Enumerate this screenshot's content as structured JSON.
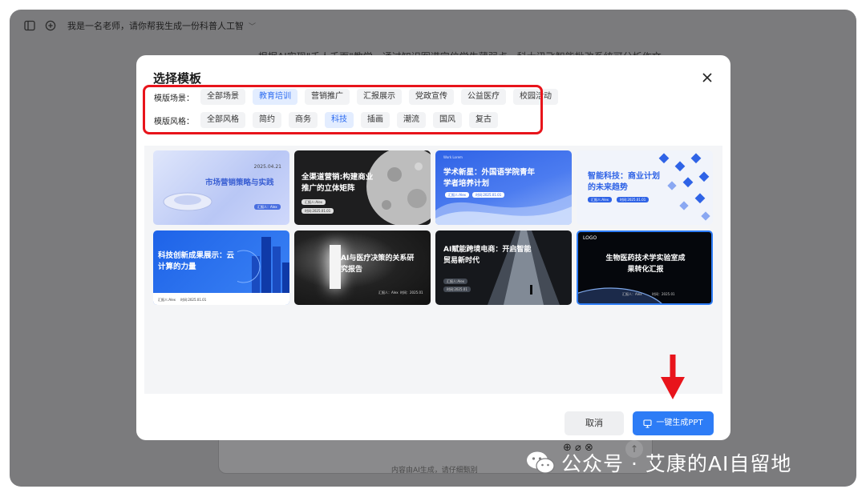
{
  "topbar": {
    "chat_title": "我是一名老师，请你帮我生成一份科普人工智",
    "chevron": "﹀",
    "icons": [
      "sidebar-toggle-icon",
      "new-chat-icon"
    ]
  },
  "background": {
    "partial_text": "根据AI实现\"千人千面\"教学，通过知识图谱定位学生薄弱点，科大讯飞智能批改系统可分析作文",
    "footnote": "内容由AI生成，请仔细甄别"
  },
  "dialog": {
    "title": "选择模板",
    "close_icon": "close-icon",
    "scene": {
      "label": "模版场景：",
      "options": [
        "全部场景",
        "教育培训",
        "营销推广",
        "汇报展示",
        "党政宣传",
        "公益医疗",
        "校园活动"
      ],
      "selected": "教育培训"
    },
    "style": {
      "label": "模版风格：",
      "options": [
        "全部风格",
        "简约",
        "商务",
        "科技",
        "插画",
        "潮流",
        "国风",
        "复古"
      ],
      "selected": "科技"
    },
    "templates": [
      {
        "title": "市场营销策略与实践",
        "date": "2025.04.21",
        "tag": "汇报人：Alex"
      },
      {
        "title": "全渠道营销:构建商业推广的立体矩阵",
        "tag": "汇报人:Alex",
        "date": "时间:2025.01.01"
      },
      {
        "title": "学术新星：外国语学院青年学者培养计划",
        "tag": "汇报人:Alex",
        "date": "时间:2025.01.01",
        "corner": "Work Lorem"
      },
      {
        "title": "智能科技：商业计划的未来趋势",
        "tag": "汇报人:Alex",
        "date": "时间:2025.01.01"
      },
      {
        "title": "科技创新成果展示：云计算的力量",
        "tag": "汇报人:Alex",
        "date": "时间:2025.01.01"
      },
      {
        "title": "AI与医疗决策的关系研究报告",
        "tag": "汇报人：Alex",
        "date": "时间：2025.01"
      },
      {
        "title": "AI赋能跨境电商：开启智能贸易新时代",
        "tag": "汇报人:Alex",
        "date": "时间:2025.01"
      },
      {
        "title": "生物医药技术学实验室成果转化汇报",
        "logo": "LOGO",
        "tag": "汇报人：Alex",
        "date": "时间：2025.01"
      }
    ],
    "cancel_label": "取消",
    "generate_label": "一键生成PPT"
  },
  "watermark": {
    "text": "公众号 · 艾康的AI自留地"
  },
  "colors": {
    "accent": "#2d7cf6",
    "highlight_box": "#e8141b",
    "overlay": "#7b7b7d"
  }
}
